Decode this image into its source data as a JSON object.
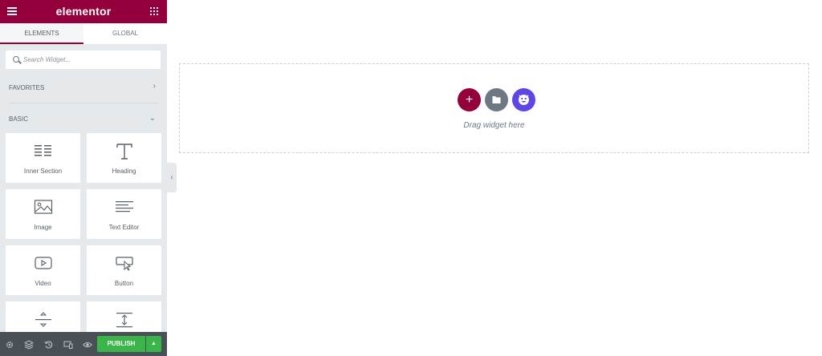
{
  "header": {
    "brand": "elementor",
    "menu_icon": "hamburger-menu-icon",
    "grid_icon": "apps-grid-icon",
    "accent_color": "#93003c"
  },
  "tabs": [
    {
      "label": "ELEMENTS",
      "active": true
    },
    {
      "label": "GLOBAL",
      "active": false
    }
  ],
  "search": {
    "placeholder": "Search Widget..."
  },
  "sections": {
    "favorites": "FAVORITES",
    "basic": "BASIC"
  },
  "widgets": [
    {
      "label": "Inner Section",
      "icon": "inner-section-icon"
    },
    {
      "label": "Heading",
      "icon": "heading-icon"
    },
    {
      "label": "Image",
      "icon": "image-icon"
    },
    {
      "label": "Text Editor",
      "icon": "text-editor-icon"
    },
    {
      "label": "Video",
      "icon": "video-icon"
    },
    {
      "label": "Button",
      "icon": "button-icon"
    },
    {
      "label": "",
      "icon": "divider-icon"
    },
    {
      "label": "",
      "icon": "spacer-icon"
    }
  ],
  "footer": {
    "icons": [
      "settings-icon",
      "navigator-layers-icon",
      "history-icon",
      "responsive-mode-icon",
      "preview-eye-icon"
    ],
    "publish_label": "PUBLISH",
    "publish_color": "#39b54a"
  },
  "canvas": {
    "drag_text": "Drag widget here",
    "add_section_icon": "plus-icon",
    "template_icon": "folder-icon",
    "third_icon": "emoji-face-icon"
  }
}
